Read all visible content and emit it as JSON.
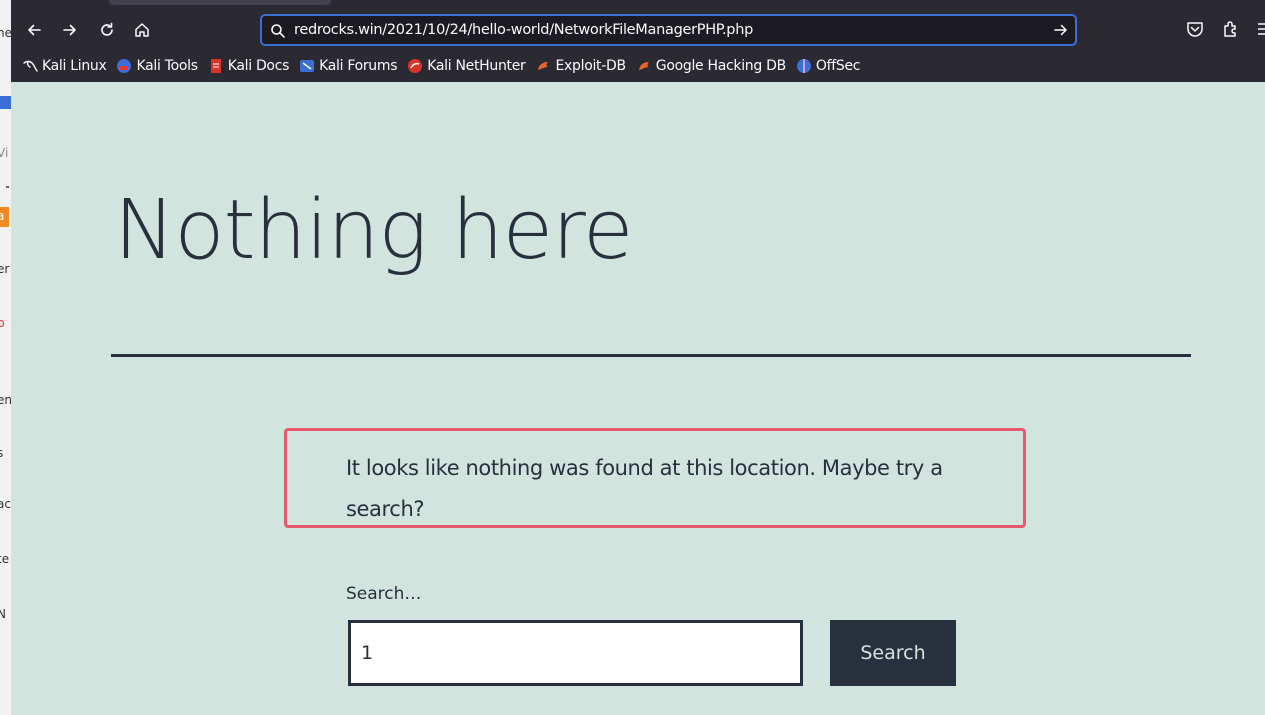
{
  "browser": {
    "url": "redrocks.win/2021/10/24/hello-world/NetworkFileManagerPHP.php",
    "bookmarks": [
      {
        "label": "Kali Linux",
        "icon": "kali-dragon-icon"
      },
      {
        "label": "Kali Tools",
        "icon": "kali-tools-icon"
      },
      {
        "label": "Kali Docs",
        "icon": "kali-docs-icon"
      },
      {
        "label": "Kali Forums",
        "icon": "kali-forums-icon"
      },
      {
        "label": "Kali NetHunter",
        "icon": "kali-nethunter-icon"
      },
      {
        "label": "Exploit-DB",
        "icon": "exploit-db-icon"
      },
      {
        "label": "Google Hacking DB",
        "icon": "ghdb-icon"
      },
      {
        "label": "OffSec",
        "icon": "offsec-icon"
      }
    ]
  },
  "left_window_fragments": [
    "he",
    "Vi",
    "a",
    "er",
    "p",
    "en",
    "s",
    "ac",
    "te",
    "N"
  ],
  "page": {
    "title": "Nothing here",
    "message": "It looks like nothing was found at this location. Maybe try a search?",
    "search_label": "Search…",
    "search_value": "1",
    "search_button": "Search"
  },
  "colors": {
    "page_bg": "#d1e4dd",
    "text": "#28303d",
    "highlight_border": "#e55a6e",
    "chrome_bg": "#2b2a33",
    "urlbar_focus": "#3a6fd3"
  }
}
